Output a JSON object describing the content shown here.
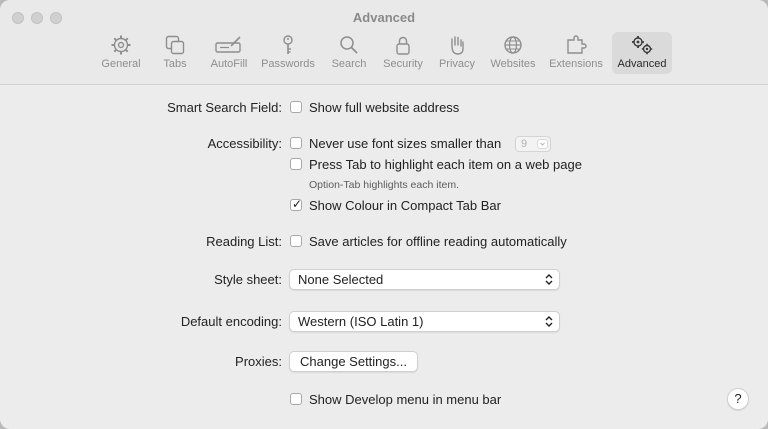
{
  "window": {
    "title": "Advanced"
  },
  "toolbar": {
    "items": [
      {
        "label": "General",
        "icon": "gear-icon"
      },
      {
        "label": "Tabs",
        "icon": "tabs-icon"
      },
      {
        "label": "AutoFill",
        "icon": "autofill-icon"
      },
      {
        "label": "Passwords",
        "icon": "key-icon"
      },
      {
        "label": "Search",
        "icon": "search-icon"
      },
      {
        "label": "Security",
        "icon": "lock-icon"
      },
      {
        "label": "Privacy",
        "icon": "hand-icon"
      },
      {
        "label": "Websites",
        "icon": "globe-icon"
      },
      {
        "label": "Extensions",
        "icon": "puzzle-icon"
      },
      {
        "label": "Advanced",
        "icon": "gears-icon",
        "active": true
      }
    ]
  },
  "settings": {
    "smart_search": {
      "label": "Smart Search Field:",
      "option": "Show full website address",
      "checked": false
    },
    "accessibility": {
      "label": "Accessibility:",
      "font_size": {
        "option": "Never use font sizes smaller than",
        "value": "9",
        "checked": false
      },
      "press_tab": {
        "option": "Press Tab to highlight each item on a web page",
        "checked": false,
        "hint": "Option-Tab highlights each item."
      },
      "compact_tab": {
        "option": "Show Colour in Compact Tab Bar",
        "checked": true
      }
    },
    "reading_list": {
      "label": "Reading List:",
      "option": "Save articles for offline reading automatically",
      "checked": false
    },
    "style_sheet": {
      "label": "Style sheet:",
      "value": "None Selected"
    },
    "default_encoding": {
      "label": "Default encoding:",
      "value": "Western (ISO Latin 1)"
    },
    "proxies": {
      "label": "Proxies:",
      "button": "Change Settings..."
    },
    "develop_menu": {
      "option": "Show Develop menu in menu bar",
      "checked": false
    }
  },
  "help": {
    "label": "?"
  }
}
